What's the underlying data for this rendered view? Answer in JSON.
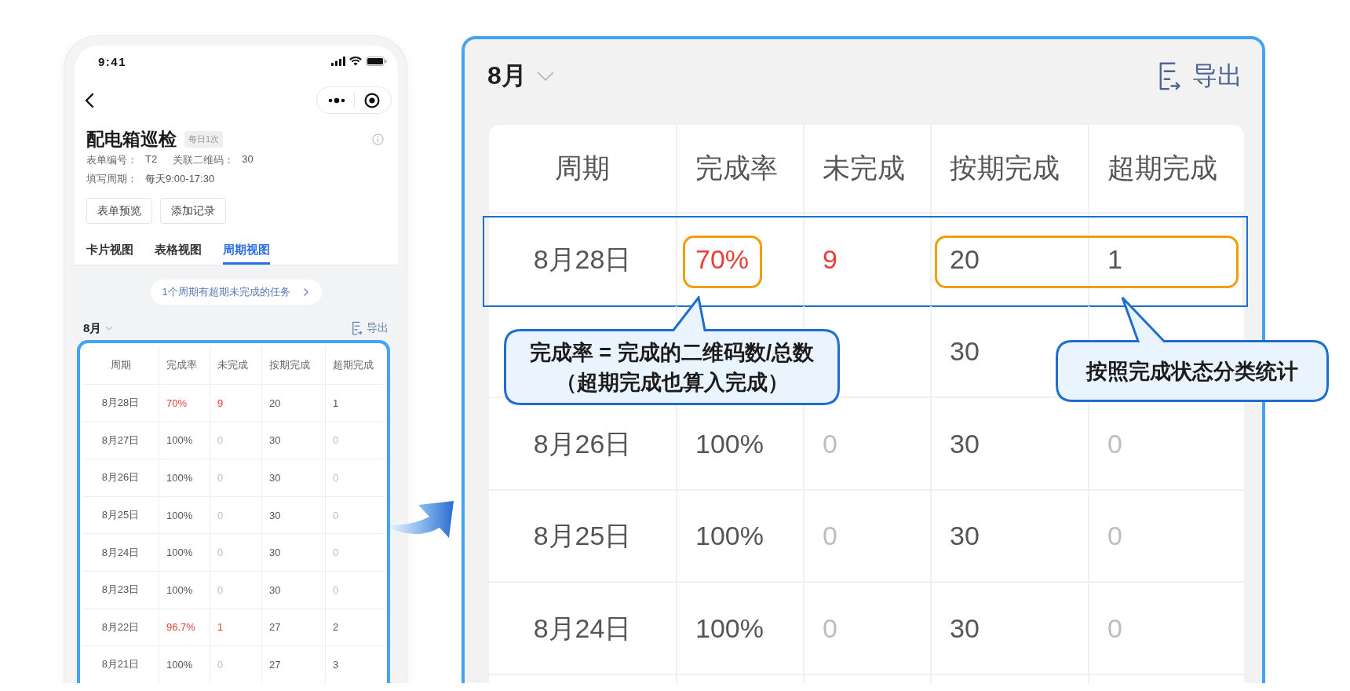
{
  "phone": {
    "status_bar": {
      "time": "9:41"
    },
    "header": {
      "title": "配电箱巡检",
      "tag": "每日1次",
      "meta_lines": [
        [
          {
            "label": "表单编号：",
            "value": "T2"
          },
          {
            "label": "关联二维码：",
            "value": "30"
          }
        ],
        [
          {
            "label": "填写周期：",
            "value": "每天9:00-17:30"
          }
        ]
      ],
      "buttons": [
        "表单预览",
        "添加记录"
      ]
    },
    "tabs": [
      {
        "label": "卡片视图",
        "selected": false
      },
      {
        "label": "表格视图",
        "selected": false
      },
      {
        "label": "周期视图",
        "selected": true
      }
    ],
    "notice": "1个周期有超期未完成的任务",
    "toolbar": {
      "month": "8月",
      "export": "导出"
    },
    "table": {
      "columns": [
        "周期",
        "完成率",
        "未完成",
        "按期完成",
        "超期完成"
      ],
      "rows": [
        {
          "cells": [
            {
              "text": "8月28日",
              "kind": "normal"
            },
            {
              "text": "70%",
              "kind": "alert"
            },
            {
              "text": "9",
              "kind": "alert"
            },
            {
              "text": "20",
              "kind": "normal"
            },
            {
              "text": "1",
              "kind": "normal"
            }
          ]
        },
        {
          "cells": [
            {
              "text": "8月27日",
              "kind": "normal"
            },
            {
              "text": "100%",
              "kind": "normal"
            },
            {
              "text": "0",
              "kind": "muted"
            },
            {
              "text": "30",
              "kind": "normal"
            },
            {
              "text": "0",
              "kind": "muted"
            }
          ]
        },
        {
          "cells": [
            {
              "text": "8月26日",
              "kind": "normal"
            },
            {
              "text": "100%",
              "kind": "normal"
            },
            {
              "text": "0",
              "kind": "muted"
            },
            {
              "text": "30",
              "kind": "normal"
            },
            {
              "text": "0",
              "kind": "muted"
            }
          ]
        },
        {
          "cells": [
            {
              "text": "8月25日",
              "kind": "normal"
            },
            {
              "text": "100%",
              "kind": "normal"
            },
            {
              "text": "0",
              "kind": "muted"
            },
            {
              "text": "30",
              "kind": "normal"
            },
            {
              "text": "0",
              "kind": "muted"
            }
          ]
        },
        {
          "cells": [
            {
              "text": "8月24日",
              "kind": "normal"
            },
            {
              "text": "100%",
              "kind": "normal"
            },
            {
              "text": "0",
              "kind": "muted"
            },
            {
              "text": "30",
              "kind": "normal"
            },
            {
              "text": "0",
              "kind": "muted"
            }
          ]
        },
        {
          "cells": [
            {
              "text": "8月23日",
              "kind": "normal"
            },
            {
              "text": "100%",
              "kind": "normal"
            },
            {
              "text": "0",
              "kind": "muted"
            },
            {
              "text": "30",
              "kind": "normal"
            },
            {
              "text": "0",
              "kind": "muted"
            }
          ]
        },
        {
          "cells": [
            {
              "text": "8月22日",
              "kind": "normal"
            },
            {
              "text": "96.7%",
              "kind": "alert"
            },
            {
              "text": "1",
              "kind": "alert"
            },
            {
              "text": "27",
              "kind": "normal"
            },
            {
              "text": "2",
              "kind": "normal"
            }
          ]
        },
        {
          "cells": [
            {
              "text": "8月21日",
              "kind": "normal"
            },
            {
              "text": "100%",
              "kind": "normal"
            },
            {
              "text": "0",
              "kind": "muted"
            },
            {
              "text": "27",
              "kind": "normal"
            },
            {
              "text": "3",
              "kind": "normal"
            }
          ]
        }
      ]
    }
  },
  "detail_panel": {
    "toolbar": {
      "month": "8月",
      "export": "导出"
    },
    "table": {
      "columns": [
        "周期",
        "完成率",
        "未完成",
        "按期完成",
        "超期完成"
      ],
      "rows": [
        {
          "framed": true,
          "cells": [
            {
              "text": "8月28日",
              "kind": "normal",
              "ringed": false
            },
            {
              "text": "70%",
              "kind": "alert",
              "ringed": true
            },
            {
              "text": "9",
              "kind": "alert",
              "ringed": false
            },
            {
              "text": "20",
              "kind": "normal",
              "ringed": true
            },
            {
              "text": "1",
              "kind": "normal",
              "ringed": true
            }
          ]
        },
        {
          "framed": false,
          "cells": [
            null,
            null,
            null,
            {
              "text": "30",
              "kind": "normal",
              "ringed": false
            },
            null
          ]
        },
        {
          "framed": false,
          "cells": [
            {
              "text": "8月26日",
              "kind": "normal",
              "ringed": false
            },
            {
              "text": "100%",
              "kind": "normal",
              "ringed": false
            },
            {
              "text": "0",
              "kind": "muted",
              "ringed": false
            },
            {
              "text": "30",
              "kind": "normal",
              "ringed": false
            },
            {
              "text": "0",
              "kind": "muted",
              "ringed": false
            }
          ]
        },
        {
          "framed": false,
          "cells": [
            {
              "text": "8月25日",
              "kind": "normal",
              "ringed": false
            },
            {
              "text": "100%",
              "kind": "normal",
              "ringed": false
            },
            {
              "text": "0",
              "kind": "muted",
              "ringed": false
            },
            {
              "text": "30",
              "kind": "normal",
              "ringed": false
            },
            {
              "text": "0",
              "kind": "muted",
              "ringed": false
            }
          ]
        },
        {
          "framed": false,
          "cells": [
            {
              "text": "8月24日",
              "kind": "normal",
              "ringed": false
            },
            {
              "text": "100%",
              "kind": "normal",
              "ringed": false
            },
            {
              "text": "0",
              "kind": "muted",
              "ringed": false
            },
            {
              "text": "30",
              "kind": "normal",
              "ringed": false
            },
            {
              "text": "0",
              "kind": "muted",
              "ringed": false
            }
          ]
        }
      ]
    },
    "callouts": [
      {
        "lines": [
          "完成率 = 完成的二维码数/总数",
          "（超期完成也算入完成）"
        ]
      },
      {
        "lines": [
          "按照完成状态分类统计"
        ]
      }
    ]
  }
}
